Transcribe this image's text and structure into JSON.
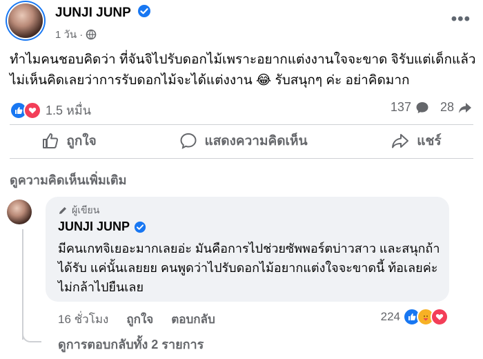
{
  "post": {
    "author": "JUNJI JUNP",
    "time": "1 วัน",
    "separator": "·",
    "text": "ทำไมคนชอบคิดว่า ที่จันจิไปรับดอกไม้เพราะอยากแต่งงานใจจะขาด จิรับแต่เด็กแล้วไม่เห็นคิดเลยว่าการรับดอกไม้จะได้แต่งงาน 😂 รับสนุกๆ ค่ะ อย่าคิดมาก",
    "reaction_count": "1.5 หมื่น",
    "comment_count": "137",
    "share_count": "28"
  },
  "actions": {
    "like": "ถูกใจ",
    "comment": "แสดงความคิดเห็น",
    "share": "แชร์"
  },
  "comments_section": {
    "more_label": "ดูความคิดเห็นเพิ่มเติม",
    "comment": {
      "badge": "ผู้เขียน",
      "author": "JUNJI JUNP",
      "text": "มีคนเกทจิเยอะมากเลยอ่ะ มันคือการไปช่วยซัพพอร์ตบ่าวสาว และสนุกถ้าได้รับ แค่นั้นเลยยย คนพูดว่าไปรับดอกไม้อยากแต่งใจจะขาดนี้ ท้อเลยค่ะ ไม่กล้าไปยืนเลย",
      "time": "16 ชั่วโมง",
      "like": "ถูกใจ",
      "reply": "ตอบกลับ",
      "reaction_count": "224"
    },
    "view_replies": "ดูการตอบกลับทั้ง 2 รายการ"
  },
  "colors": {
    "accent": "#1877f2",
    "love": "#f33e58",
    "care": "#f7b125",
    "muted": "#65676b",
    "bubble": "#f0f2f5"
  }
}
